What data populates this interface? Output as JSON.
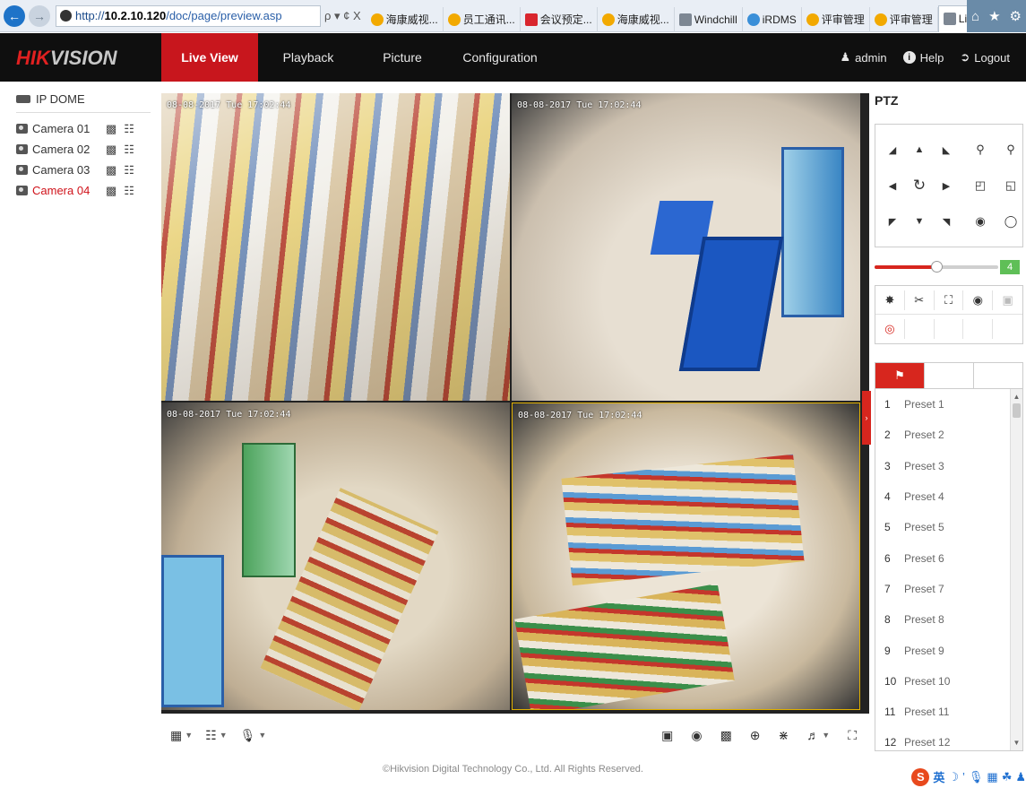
{
  "browser": {
    "url_prefix": "http://",
    "url_host": "10.2.10.120",
    "url_path": "/doc/page/preview.asp",
    "addr_controls": "ρ ▾ ¢ X",
    "tabs": [
      {
        "label": "海康威视...",
        "icon": "orange"
      },
      {
        "label": "员工通讯...",
        "icon": "orange"
      },
      {
        "label": "会议预定...",
        "icon": "red"
      },
      {
        "label": "海康威视...",
        "icon": "orange"
      },
      {
        "label": "Windchill",
        "icon": "gray"
      },
      {
        "label": "iRDMS",
        "icon": "blue"
      },
      {
        "label": "评审管理",
        "icon": "orange"
      },
      {
        "label": "评审管理",
        "icon": "orange"
      },
      {
        "label": "Live ...",
        "icon": "gray",
        "active": true
      }
    ],
    "close_glyph": "×"
  },
  "header": {
    "logo_red": "HIK",
    "logo_rest": "VISION",
    "nav": {
      "live_view": "Live View",
      "playback": "Playback",
      "picture": "Picture",
      "configuration": "Configuration"
    },
    "user": "admin",
    "help": "Help",
    "logout": "Logout"
  },
  "tree": {
    "root": "IP DOME",
    "cameras": [
      {
        "label": "Camera 01",
        "selected": false
      },
      {
        "label": "Camera 02",
        "selected": false
      },
      {
        "label": "Camera 03",
        "selected": false
      },
      {
        "label": "Camera 04",
        "selected": true
      }
    ]
  },
  "video": {
    "timestamps": [
      "08-08-2017 Tue 17:02:44",
      "08-08-2017 Tue 17:02:44",
      "08-08-2017 Tue 17:02:44",
      "08-08-2017 Tue 17:02:44"
    ]
  },
  "ptz": {
    "title": "PTZ",
    "speed": 4,
    "speed_min": 1,
    "speed_max": 7,
    "presets": [
      {
        "num": "1",
        "name": "Preset 1"
      },
      {
        "num": "2",
        "name": "Preset 2"
      },
      {
        "num": "3",
        "name": "Preset 3"
      },
      {
        "num": "4",
        "name": "Preset 4"
      },
      {
        "num": "5",
        "name": "Preset 5"
      },
      {
        "num": "6",
        "name": "Preset 6"
      },
      {
        "num": "7",
        "name": "Preset 7"
      },
      {
        "num": "8",
        "name": "Preset 8"
      },
      {
        "num": "9",
        "name": "Preset 9"
      },
      {
        "num": "10",
        "name": "Preset 10"
      },
      {
        "num": "11",
        "name": "Preset 11"
      },
      {
        "num": "12",
        "name": "Preset 12"
      }
    ]
  },
  "footer": "©Hikvision Digital Technology Co., Ltd. All Rights Reserved.",
  "ime": {
    "brand": "S",
    "lang": "英"
  },
  "colors": {
    "accent": "#c8161d",
    "speed_badge": "#5fbf57",
    "selected_tile": "#e0b000"
  }
}
